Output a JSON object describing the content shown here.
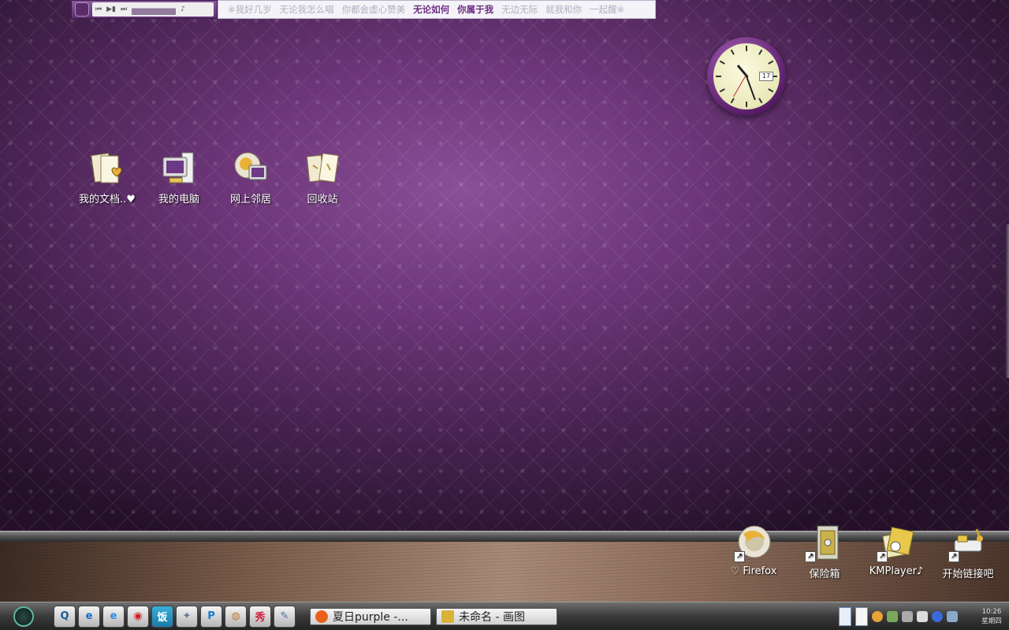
{
  "music_bar": {
    "lyrics": [
      {
        "text": "※我好几岁",
        "highlight": false
      },
      {
        "text": "无论我怎么唱",
        "highlight": false
      },
      {
        "text": "你都会虚心赞美",
        "highlight": false
      },
      {
        "text": "无论如何",
        "highlight": true
      },
      {
        "text": "你属于我",
        "highlight": true
      },
      {
        "text": "无边无际",
        "highlight": false
      },
      {
        "text": "就我和你",
        "highlight": false
      },
      {
        "text": "一起醒※",
        "highlight": false
      }
    ],
    "controls": {
      "prev": "⏮",
      "play": "▶▮",
      "next": "⏭",
      "note": "♪"
    }
  },
  "clock_widget": {
    "date": "17"
  },
  "desktop_icons": [
    {
      "label": "我的文档..♥",
      "icon": "my-documents-icon"
    },
    {
      "label": "我的电脑",
      "icon": "my-computer-icon"
    },
    {
      "label": "网上邻居",
      "icon": "network-places-icon"
    },
    {
      "label": "回收站",
      "icon": "recycle-bin-icon"
    }
  ],
  "shelf_icons": [
    {
      "label": "♡ Firefox",
      "icon": "firefox-icon"
    },
    {
      "label": "保险箱",
      "icon": "safe-icon"
    },
    {
      "label": "KMPlayer♪",
      "icon": "kmplayer-icon"
    },
    {
      "label": "开始链接吧",
      "icon": "connect-icon"
    }
  ],
  "taskbar": {
    "quick_launch": [
      {
        "glyph": "Q",
        "icon": "qq-icon"
      },
      {
        "glyph": "e",
        "icon": "ie-icon"
      },
      {
        "glyph": "e",
        "icon": "ie-blue-icon"
      },
      {
        "glyph": "◉",
        "icon": "opera-icon"
      },
      {
        "glyph": "饭",
        "icon": "fanfou-icon"
      },
      {
        "glyph": "✦",
        "icon": "tool-icon"
      },
      {
        "glyph": "P",
        "icon": "pplive-icon"
      },
      {
        "glyph": "◍",
        "icon": "game-icon"
      },
      {
        "glyph": "秀",
        "icon": "meitu-icon"
      },
      {
        "glyph": "✎",
        "icon": "paint-quick-icon"
      }
    ],
    "tasks": [
      {
        "label": "夏日purple -...",
        "icon": "firefox-task-icon",
        "color": "#e8621a"
      },
      {
        "label": "未命名 - 画图",
        "icon": "paint-task-icon",
        "color": "#d9b23a"
      }
    ],
    "tray_clock": {
      "time": "10:26",
      "day": "星期四"
    }
  },
  "colors": {
    "wallpaper": "#6b3577",
    "lyric_highlight": "#6e2c82"
  }
}
